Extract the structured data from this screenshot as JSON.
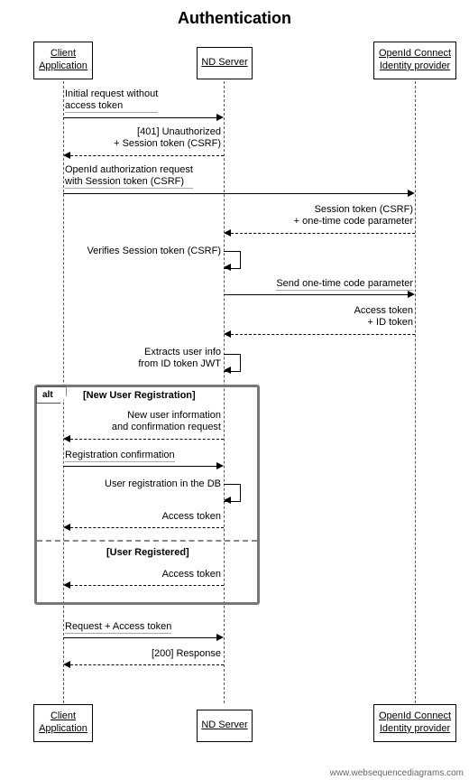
{
  "title": "Authentication",
  "participants": {
    "client": "Client Application",
    "nd": "ND Server",
    "idp": "OpenId Connect Identity provider"
  },
  "messages": {
    "m1": "Initial request without\naccess token",
    "m2": "[401] Unauthorized\n+ Session token (CSRF)",
    "m3": "OpenId authorization request\nwith Session token (CSRF)",
    "m4": "Session token (CSRF)\n+ one-time code parameter",
    "m5": "Verifies Session token (CSRF)",
    "m6": "Send one-time code parameter",
    "m7": "Access token\n+ ID token",
    "m8": "Extracts user info\nfrom ID token JWT",
    "m9": "New user information\nand confirmation request",
    "m10": "Registration confirmation",
    "m11": "User registration in the DB",
    "m12": "Access token",
    "m13": "Access token",
    "m14": "Request + Access token",
    "m15": "[200] Response"
  },
  "alt": {
    "label": "alt",
    "section1": "[New User Registration]",
    "section2": "[User Registered]"
  },
  "watermark": "www.websequencediagrams.com"
}
